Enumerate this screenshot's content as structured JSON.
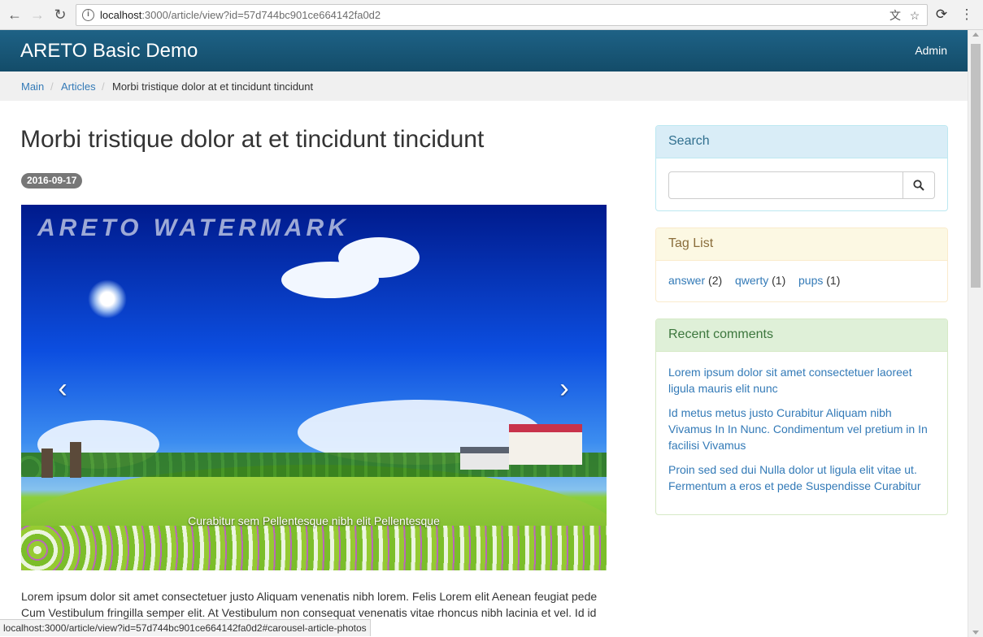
{
  "browser": {
    "url_host": "localhost",
    "url_rest": ":3000/article/view?id=57d744bc901ce664142fa0d2",
    "status_url": "localhost:3000/article/view?id=57d744bc901ce664142fa0d2#carousel-article-photos"
  },
  "navbar": {
    "brand": "ARETO Basic Demo",
    "admin_label": "Admin"
  },
  "breadcrumb": {
    "items": [
      "Main",
      "Articles",
      "Morbi tristique dolor at et tincidunt tincidunt"
    ],
    "separator": "/"
  },
  "article": {
    "title": "Morbi tristique dolor at et tincidunt tincidunt",
    "date": "2016-09-17",
    "carousel": {
      "watermark": "ARETO WATERMARK",
      "caption": "Curabitur sem Pellentesque nibh elit Pellentesque",
      "prev_icon": "chevron-left-icon",
      "next_icon": "chevron-right-icon"
    },
    "body": "Lorem ipsum dolor sit amet consectetuer justo Aliquam venenatis nibh lorem. Felis Lorem elit Aenean feugiat pede Cum Vestibulum fringilla semper elit. At Vestibulum non consequat venenatis vitae rhoncus nibh lacinia et vel. Id id"
  },
  "sidebar": {
    "search": {
      "heading": "Search",
      "placeholder": "",
      "button_icon": "search-icon"
    },
    "tags": {
      "heading": "Tag List",
      "items": [
        {
          "name": "answer",
          "count": "(2)"
        },
        {
          "name": "qwerty",
          "count": "(1)"
        },
        {
          "name": "pups",
          "count": "(1)"
        }
      ]
    },
    "comments": {
      "heading": "Recent comments",
      "items": [
        "Lorem ipsum dolor sit amet consectetuer laoreet ligula mauris elit nunc",
        "Id metus metus justo Curabitur Aliquam nibh Vivamus In In Nunc. Condimentum vel pretium in In facilisi Vivamus",
        "Proin sed sed dui Nulla dolor ut ligula elit vitae ut. Fermentum a eros et pede Suspendisse Curabitur"
      ]
    }
  },
  "colors": {
    "navbar": "#1e6286",
    "link": "#337ab7",
    "badge": "#777777"
  }
}
